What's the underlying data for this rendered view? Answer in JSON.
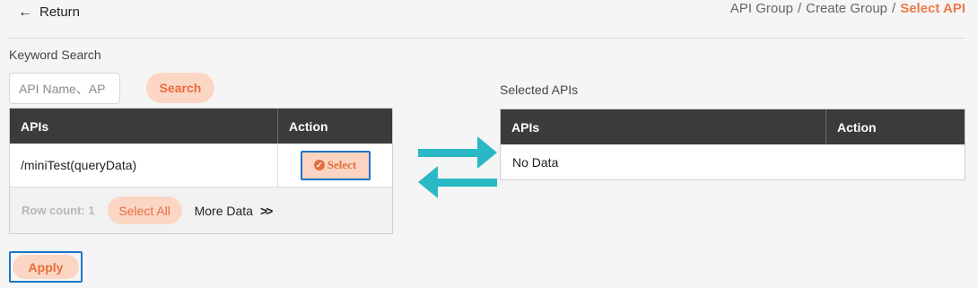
{
  "nav": {
    "return_label": "Return",
    "breadcrumb": [
      "API Group",
      "Create Group",
      "Select API"
    ],
    "separator": "/"
  },
  "search": {
    "label": "Keyword Search",
    "placeholder": "API Name、AP",
    "button_label": "Search"
  },
  "available_table": {
    "columns": [
      "APIs",
      "Action"
    ],
    "rows": [
      {
        "api": "/miniTest(queryData)",
        "action_label": "Select"
      }
    ],
    "row_count_label": "Row count: 1",
    "select_all_label": "Select All",
    "more_data_label": "More Data"
  },
  "selected_table": {
    "label": "Selected APIs",
    "columns": [
      "APIs",
      "Action"
    ],
    "empty_text": "No Data"
  },
  "apply_label": "Apply",
  "colors": {
    "accent": "#e86d3d",
    "accent_light": "#fcd6c4",
    "header_dark": "#3b3b3b",
    "arrow_teal": "#2ab9c4",
    "focus_blue": "#1f74c6"
  }
}
